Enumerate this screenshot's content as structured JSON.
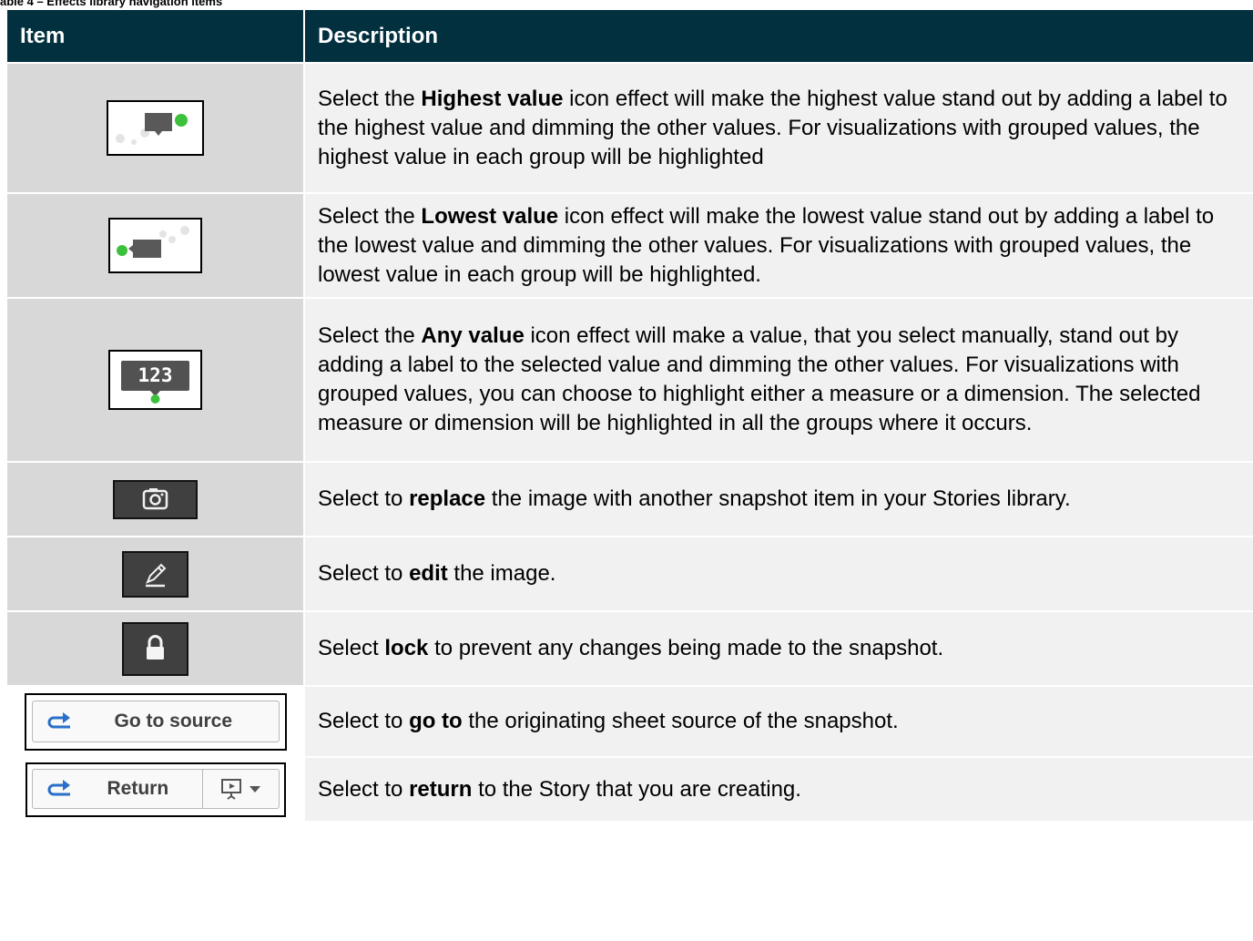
{
  "caption": "able 4 – Effects library navigation items",
  "table": {
    "headers": {
      "item": "Item",
      "description": "Description"
    },
    "rows": [
      {
        "icon": "highest-value-icon",
        "pre": "Select the ",
        "bold": "Highest value",
        "post": " icon effect will make the highest value stand out by adding a label to the highest value and dimming the other values. For visualizations with grouped values, the highest value in each group will be highlighted"
      },
      {
        "icon": "lowest-value-icon",
        "pre": "Select the ",
        "bold": "Lowest value",
        "post": " icon effect will make the lowest value stand out by adding a label to the lowest value and dimming the other values. For visualizations with grouped values, the lowest value in each group will be highlighted."
      },
      {
        "icon": "any-value-icon",
        "icon_text": "123",
        "pre": "Select the ",
        "bold": "Any value",
        "post": " icon effect will make a value, that you select manually, stand out by adding a label to the selected value and dimming the other values. For visualizations with grouped values, you can choose to highlight either a measure or a dimension. The selected measure or dimension will be highlighted in all the groups where it occurs."
      },
      {
        "icon": "camera-icon",
        "pre": "Select to ",
        "bold": "replace",
        "post": " the image with another snapshot item in your Stories library."
      },
      {
        "icon": "pencil-icon",
        "pre": "Select to ",
        "bold": "edit",
        "post": " the image."
      },
      {
        "icon": "lock-icon",
        "pre": "Select ",
        "bold": "lock",
        "post": " to prevent any changes being made to the snapshot."
      },
      {
        "icon": "go-to-source-icon",
        "button_label": "Go to source",
        "pre": "Select to ",
        "bold": "go to",
        "post": " the originating sheet source of the snapshot."
      },
      {
        "icon": "return-icon",
        "button_label": "Return",
        "pre": "Select to ",
        "bold": "return",
        "post": " to the Story that you are creating."
      }
    ]
  },
  "colors": {
    "header_bg": "#02303f",
    "item_bg": "#d8d8d8",
    "desc_bg": "#f1f1f1",
    "accent_green": "#3cc13c",
    "icon_dark": "#404040"
  }
}
